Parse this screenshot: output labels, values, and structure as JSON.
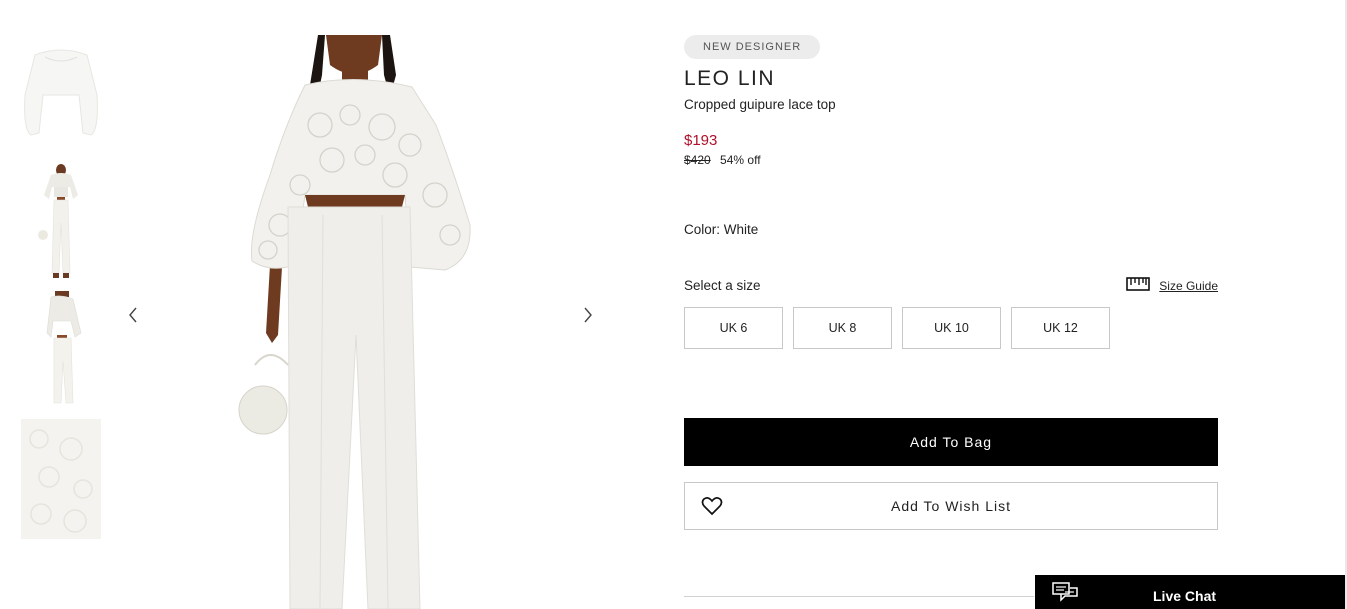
{
  "gallery": {
    "thumbnails": [
      "front-detail",
      "model-full",
      "model-side",
      "lace-closeup"
    ],
    "prev_icon": "chevron-left-icon",
    "next_icon": "chevron-right-icon"
  },
  "product": {
    "badge": "NEW DESIGNER",
    "brand": "LEO LIN",
    "name": "Cropped guipure lace top",
    "price_now": "$193",
    "price_was": "$420",
    "discount": "54% off",
    "color_label": "Color: White"
  },
  "size": {
    "heading": "Select a size",
    "guide_icon": "ruler-icon",
    "guide_label": "Size Guide",
    "options": [
      "UK 6",
      "UK 8",
      "UK 10",
      "UK 12"
    ]
  },
  "actions": {
    "add_to_bag": "Add To Bag",
    "add_to_wishlist": "Add To Wish List",
    "wishlist_icon": "heart-icon"
  },
  "chat": {
    "label": "Live Chat",
    "icon": "chat-bubbles-icon"
  },
  "colors": {
    "sale_price": "#b0102a",
    "primary_button": "#000000",
    "badge_bg": "#ececec"
  }
}
